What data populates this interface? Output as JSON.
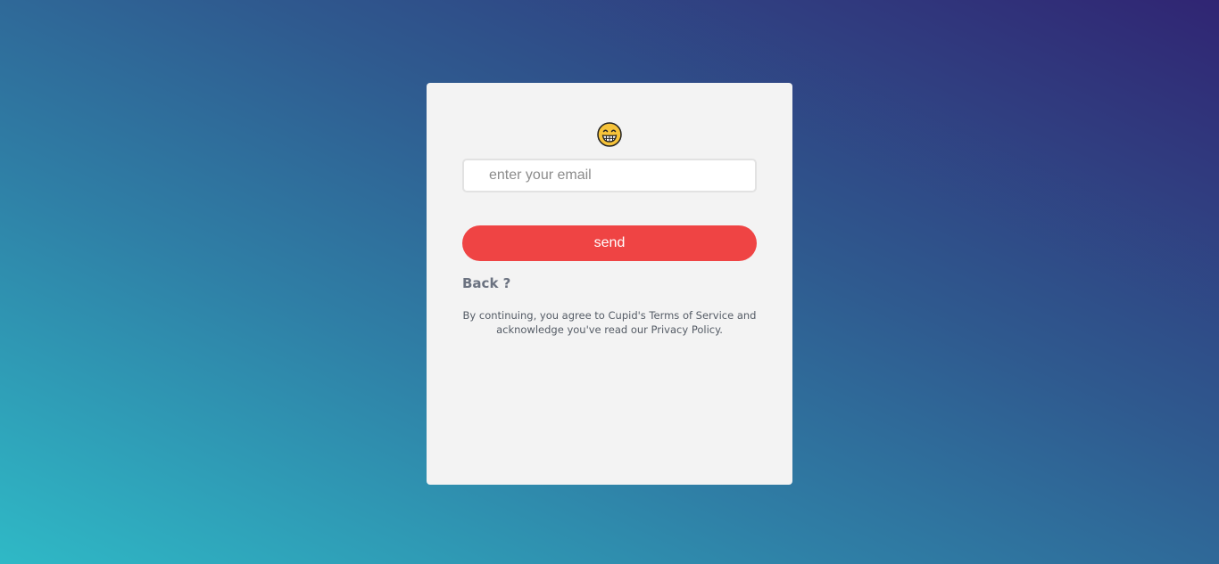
{
  "form": {
    "emoji_icon": "grinning-face-icon",
    "email": {
      "placeholder": "enter your email",
      "value": ""
    },
    "send_label": "send",
    "back_label": "Back ?",
    "terms_line1": "By continuing, you agree to Cupid's Terms of Service and",
    "terms_line2": "acknowledge you've read our Privacy Policy."
  },
  "colors": {
    "button": "#ef4444",
    "card": "#f3f3f3",
    "gradient_start": "#2fb9c6",
    "gradient_end": "#302573"
  }
}
